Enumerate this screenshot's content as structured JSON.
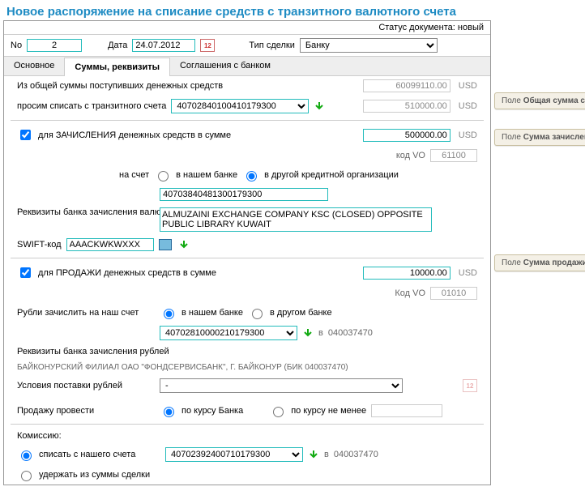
{
  "title": "Новое распоряжение на списание средств с транзитного валютного счета",
  "status_label": "Статус документа:",
  "status_value": "новый",
  "top": {
    "no_label": "No",
    "no_value": "2",
    "date_label": "Дата",
    "date_value": "24.07.2012",
    "deal_type_label": "Тип сделки",
    "deal_type_value": "Банку"
  },
  "tabs": [
    "Основное",
    "Суммы, реквизиты",
    "Соглашения с банком"
  ],
  "total": {
    "label": "Из общей суммы поступивших денежных средств",
    "amount": "60099110.00",
    "ccy": "USD",
    "writeoff_label": "просим списать с транзитного счета",
    "writeoff_account": "40702840100410179300",
    "writeoff_amount": "510000.00"
  },
  "credit": {
    "checkbox_label": "для ЗАЧИСЛЕНИЯ денежных средств в сумме",
    "amount": "500000.00",
    "ccy": "USD",
    "vo_label": "код VO",
    "vo_value": "61100",
    "account_label": "на счет",
    "radio1": "в нашем банке",
    "radio2": "в другой кредитной организации",
    "account_value": "40703840481300179300",
    "bank_req_label": "Реквизиты банка зачисления валюты",
    "bank_req_value": "ALMUZAINI EXCHANGE COMPANY KSC (CLOSED) OPPOSITE PUBLIC LIBRARY KUWAIT",
    "swift_label": "SWIFT-код",
    "swift_value": "AAACKWKWXXX"
  },
  "sale": {
    "checkbox_label": "для ПРОДАЖИ денежных средств в сумме",
    "amount": "10000.00",
    "ccy": "USD",
    "vo_label": "Код VO",
    "vo_value": "01010",
    "rub_label": "Рубли зачислить на наш счет",
    "radio1": "в нашем банке",
    "radio2": "в другом банке",
    "rub_account": "40702810000210179300",
    "in": "в",
    "bik": "040037470",
    "rub_bank_label": "Реквизиты банка зачисления рублей",
    "rub_bank_value": "БАЙКОНУРСКИЙ ФИЛИАЛ ОАО \"ФОНДСЕРВИСБАНК\", Г. БАЙКОНУР (БИК 040037470)",
    "terms_label": "Условия поставки рублей",
    "terms_value": "-",
    "perform_label": "Продажу провести",
    "rate1": "по курсу Банка",
    "rate2": "по курсу не менее"
  },
  "commission": {
    "title": "Комиссию:",
    "opt1": "списать с нашего счета",
    "opt2": "удержать из суммы сделки",
    "account": "40702392400710179300",
    "in": "в",
    "bik": "040037470"
  },
  "callouts": {
    "c1a": "Поле ",
    "c1b": "Общая сумма списания",
    "c2a": "Поле ",
    "c2b": "Сумма зачисления",
    "c3a": "Поле ",
    "c3b": "Сумма продажи"
  }
}
